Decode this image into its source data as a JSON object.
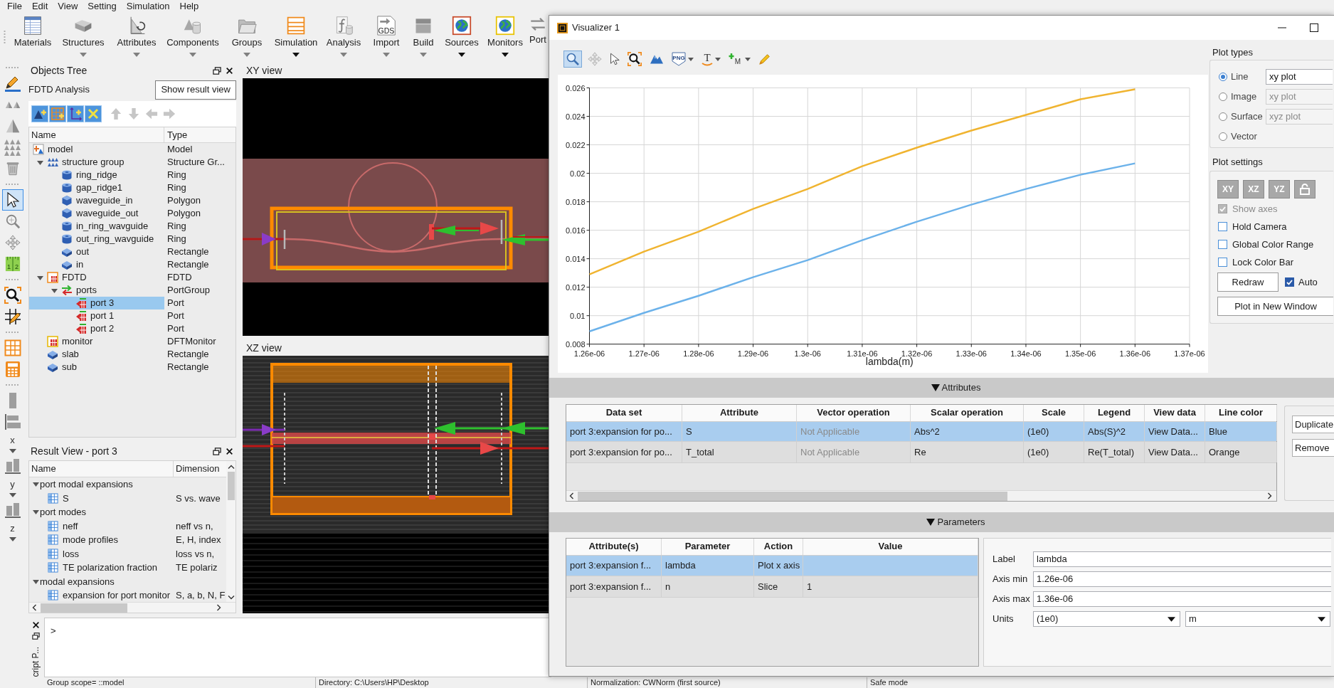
{
  "menu_bar": [
    "File",
    "Edit",
    "View",
    "Setting",
    "Simulation",
    "Help"
  ],
  "main_toolbar": [
    {
      "label": "Materials",
      "kind": "materials",
      "menu": false
    },
    {
      "label": "Structures",
      "kind": "structures",
      "menu": true,
      "menu_active": false
    },
    {
      "label": "Attributes",
      "kind": "attributes",
      "menu": true,
      "menu_active": false
    },
    {
      "label": "Components",
      "kind": "components",
      "menu": true,
      "menu_active": false
    },
    {
      "label": "Groups",
      "kind": "groups",
      "menu": true,
      "menu_active": false
    },
    {
      "label": "Simulation",
      "kind": "simulation",
      "menu": true,
      "menu_active": true
    },
    {
      "label": "Analysis",
      "kind": "analysis",
      "menu": true,
      "menu_active": false
    },
    {
      "label": "Import",
      "kind": "import",
      "menu": true,
      "menu_active": false,
      "icon_text": "GDS"
    },
    {
      "label": "Build",
      "kind": "build",
      "menu": true,
      "menu_active": false
    },
    {
      "label": "Sources",
      "kind": "sources",
      "menu": true,
      "menu_active": true
    },
    {
      "label": "Monitors",
      "kind": "monitors",
      "menu": true,
      "menu_active": true
    },
    {
      "label": "Port",
      "kind": "ports",
      "menu": false
    }
  ],
  "side_tools": [
    {
      "kind": "grip"
    },
    {
      "kind": "pencil",
      "selected": false
    },
    {
      "kind": "triangles",
      "selected": false
    },
    {
      "kind": "triangle",
      "selected": false
    },
    {
      "kind": "triangle-grid",
      "selected": false
    },
    {
      "kind": "trash",
      "selected": false
    },
    {
      "kind": "grip"
    },
    {
      "kind": "pointer",
      "selected": true
    },
    {
      "kind": "zoom",
      "selected": false
    },
    {
      "kind": "move",
      "selected": false
    },
    {
      "kind": "ruler",
      "selected": false,
      "icon_text": [
        "1",
        "2"
      ]
    },
    {
      "kind": "grip"
    },
    {
      "kind": "zoom-region",
      "selected": false
    },
    {
      "kind": "grid-edit",
      "selected": false
    },
    {
      "kind": "grip"
    },
    {
      "kind": "grid",
      "selected": false
    },
    {
      "kind": "calculator",
      "selected": false
    },
    {
      "kind": "grip"
    },
    {
      "kind": "vertical-bar",
      "selected": false
    },
    {
      "kind": "align",
      "selected": false
    },
    {
      "kind": "axis",
      "label": "x"
    },
    {
      "kind": "bars",
      "selected": false
    },
    {
      "kind": "axis",
      "label": "y"
    },
    {
      "kind": "bars",
      "selected": false
    },
    {
      "kind": "axis",
      "label": "z"
    }
  ],
  "objects_tree": {
    "title": "Objects Tree",
    "context": "FDTD Analysis",
    "show_result_button": "Show result view",
    "tools": [
      {
        "kind": "add-structure",
        "disabled": false
      },
      {
        "kind": "add-mesh",
        "disabled": false
      },
      {
        "kind": "add-axis",
        "disabled": false
      },
      {
        "kind": "delete",
        "disabled": false
      },
      {
        "kind": "up",
        "disabled": true
      },
      {
        "kind": "down",
        "disabled": true
      },
      {
        "kind": "left",
        "disabled": true
      },
      {
        "kind": "right",
        "disabled": true
      }
    ],
    "columns": [
      "Name",
      "Type"
    ],
    "items": [
      {
        "name": "model",
        "type": "Model",
        "kind": "model",
        "selected": false,
        "children": [
          {
            "name": "structure group",
            "type": "Structure Gr...",
            "kind": "group",
            "selected": false,
            "expanded": true,
            "children": [
              {
                "name": "ring_ridge",
                "type": "Ring",
                "kind": "ring",
                "selected": false
              },
              {
                "name": "gap_ridge1",
                "type": "Ring",
                "kind": "ring",
                "selected": false
              },
              {
                "name": "waveguide_in",
                "type": "Polygon",
                "kind": "polygon",
                "selected": false
              },
              {
                "name": "waveguide_out",
                "type": "Polygon",
                "kind": "polygon",
                "selected": false
              },
              {
                "name": "in_ring_wavguide",
                "type": "Ring",
                "kind": "ring",
                "selected": false
              },
              {
                "name": "out_ring_wavguide",
                "type": "Ring",
                "kind": "ring",
                "selected": false
              },
              {
                "name": "out",
                "type": "Rectangle",
                "kind": "rectangle",
                "selected": false
              },
              {
                "name": "in",
                "type": "Rectangle",
                "kind": "rectangle",
                "selected": false
              }
            ]
          },
          {
            "name": "FDTD",
            "type": "FDTD",
            "kind": "fdtd",
            "selected": false,
            "expanded": true,
            "children": [
              {
                "name": "ports",
                "type": "PortGroup",
                "kind": "portgroup",
                "selected": false,
                "expanded": true,
                "children": [
                  {
                    "name": "port 3",
                    "type": "Port",
                    "kind": "port",
                    "selected": true
                  },
                  {
                    "name": "port 1",
                    "type": "Port",
                    "kind": "port",
                    "selected": false
                  },
                  {
                    "name": "port 2",
                    "type": "Port",
                    "kind": "port",
                    "selected": false
                  }
                ]
              }
            ]
          },
          {
            "name": "monitor",
            "type": "DFTMonitor",
            "kind": "monitor",
            "selected": false
          },
          {
            "name": "slab",
            "type": "Rectangle",
            "kind": "rectangle",
            "selected": false
          },
          {
            "name": "sub",
            "type": "Rectangle",
            "kind": "rectangle",
            "selected": false
          }
        ]
      }
    ]
  },
  "result_view": {
    "title": "Result View - port 3",
    "columns": [
      "Name",
      "Dimension"
    ],
    "items": [
      {
        "name": "port modal expansions",
        "selected": false,
        "expanded": true,
        "children": [
          {
            "name": "S",
            "dimension": "S vs. wave",
            "selected": false
          }
        ]
      },
      {
        "name": "port modes",
        "selected": false,
        "expanded": true,
        "children": [
          {
            "name": "neff",
            "dimension": "neff vs n,",
            "selected": false
          },
          {
            "name": "mode profiles",
            "dimension": "E, H, index",
            "selected": false
          },
          {
            "name": "loss",
            "dimension": "loss vs n,",
            "selected": false
          },
          {
            "name": "TE polarization fraction",
            "dimension": "TE polariz",
            "selected": false
          }
        ]
      },
      {
        "name": "modal expansions",
        "selected": false,
        "expanded": true,
        "children": [
          {
            "name": "expansion for port monitor",
            "dimension": "S, a, b, N, F",
            "selected": false
          }
        ]
      }
    ]
  },
  "views": [
    {
      "title": "XY view",
      "kind": "xy"
    },
    {
      "title": "XZ view",
      "kind": "xz"
    }
  ],
  "console": {
    "tab_label": "cript P...",
    "prompt": ">"
  },
  "status_bar": [
    "Group scope= ::model",
    "Directory: C:\\Users\\HP\\Desktop",
    "Normalization: CWNorm (first source)",
    "Safe mode"
  ],
  "visualizer": {
    "title": "Visualizer 1",
    "tools": [
      {
        "kind": "zoom",
        "selected": true,
        "menu": false
      },
      {
        "kind": "pan",
        "selected": false,
        "menu": false
      },
      {
        "kind": "pointer",
        "selected": false,
        "menu": false
      },
      {
        "kind": "zoom-box",
        "selected": false,
        "menu": false
      },
      {
        "kind": "surface",
        "selected": false,
        "menu": false
      },
      {
        "kind": "png",
        "selected": false,
        "menu": true,
        "icon_text": "PNG"
      },
      {
        "kind": "text",
        "selected": false,
        "menu": true,
        "icon_text": "T"
      },
      {
        "kind": "marker",
        "selected": false,
        "menu": true,
        "icon_text": "M"
      },
      {
        "kind": "pencil",
        "selected": false,
        "menu": false
      }
    ],
    "plot": {
      "chart_data": {
        "type": "line",
        "xlabel": "lambda(m)",
        "grid": true,
        "x": [
          1.26e-06,
          1.27e-06,
          1.28e-06,
          1.29e-06,
          1.3e-06,
          1.31e-06,
          1.32e-06,
          1.33e-06,
          1.34e-06,
          1.35e-06,
          1.36e-06
        ],
        "series": [
          {
            "color": "#6cb2ea",
            "values": [
              0.0089,
              0.0102,
              0.0114,
              0.0127,
              0.0139,
              0.0153,
              0.0166,
              0.0178,
              0.0189,
              0.0199,
              0.0207
            ]
          },
          {
            "color": "#f0b430",
            "values": [
              0.0129,
              0.0145,
              0.0159,
              0.0175,
              0.0189,
              0.0205,
              0.0218,
              0.023,
              0.0241,
              0.0252,
              0.0259
            ]
          }
        ],
        "xlim": [
          1.26e-06,
          1.37e-06
        ],
        "ylim": [
          0.008,
          0.026
        ],
        "xticks": [
          {
            "value": 1.26e-06,
            "label": "1.26e-06"
          },
          {
            "value": 1.27e-06,
            "label": "1.27e-06"
          },
          {
            "value": 1.28e-06,
            "label": "1.28e-06"
          },
          {
            "value": 1.29e-06,
            "label": "1.29e-06"
          },
          {
            "value": 1.3e-06,
            "label": "1.3e-06"
          },
          {
            "value": 1.31e-06,
            "label": "1.31e-06"
          },
          {
            "value": 1.32e-06,
            "label": "1.32e-06"
          },
          {
            "value": 1.33e-06,
            "label": "1.33e-06"
          },
          {
            "value": 1.34e-06,
            "label": "1.34e-06"
          },
          {
            "value": 1.35e-06,
            "label": "1.35e-06"
          },
          {
            "value": 1.36e-06,
            "label": "1.36e-06"
          },
          {
            "value": 1.37e-06,
            "label": "1.37e-06"
          }
        ],
        "yticks": [
          0.008,
          0.01,
          0.012,
          0.014,
          0.016,
          0.018,
          0.02,
          0.022,
          0.024,
          0.026
        ]
      }
    },
    "plot_types": {
      "title": "Plot types",
      "options": [
        {
          "label": "Line",
          "selected": true,
          "field": "xy plot",
          "field_disabled": false
        },
        {
          "label": "Image",
          "selected": false,
          "field": "xy plot",
          "field_disabled": true
        },
        {
          "label": "Surface",
          "selected": false,
          "field": "xyz plot",
          "field_disabled": true
        },
        {
          "label": "Vector",
          "selected": false
        }
      ]
    },
    "plot_settings": {
      "title": "Plot settings",
      "view_buttons": [
        "XY",
        "XZ",
        "YZ"
      ],
      "options": [
        {
          "label": "Show axes",
          "checked": true,
          "disabled": true
        },
        {
          "label": "Hold Camera",
          "checked": false,
          "disabled": false
        },
        {
          "label": "Global Color Range",
          "checked": false,
          "disabled": false
        },
        {
          "label": "Lock Color Bar",
          "checked": false,
          "disabled": false
        }
      ],
      "redraw": "Redraw",
      "auto": {
        "label": "Auto",
        "checked": true
      },
      "new_window": "Plot in New Window"
    },
    "attributes": {
      "title": "Attributes",
      "expanded": true,
      "columns": [
        {
          "label": "Data set",
          "disabled": false
        },
        {
          "label": "Attribute",
          "disabled": false
        },
        {
          "label": "Vector operation",
          "disabled": true
        },
        {
          "label": "Scalar operation",
          "disabled": false
        },
        {
          "label": "Scale",
          "disabled": false
        },
        {
          "label": "Legend",
          "disabled": false
        },
        {
          "label": "View data",
          "disabled": false
        },
        {
          "label": "Line color",
          "disabled": false
        }
      ],
      "rows": [
        {
          "selected": true,
          "cells": [
            "port 3:expansion for po...",
            "S",
            "Not Applicable",
            "Abs^2",
            "(1e0)",
            "Abs(S)^2",
            "View Data...",
            "Blue"
          ]
        },
        {
          "selected": false,
          "cells": [
            "port 3:expansion for po...",
            "T_total",
            "Not Applicable",
            "Re",
            "(1e0)",
            "Re(T_total)",
            "View Data...",
            "Orange"
          ]
        }
      ],
      "buttons": [
        "Duplicate",
        "Remove"
      ]
    },
    "parameters": {
      "title": "Parameters",
      "expanded": true,
      "columns": [
        "Attribute(s)",
        "Parameter",
        "Action",
        "Value"
      ],
      "rows": [
        {
          "selected": true,
          "cells": [
            "port 3:expansion f...",
            "lambda",
            "Plot x axis"
          ]
        },
        {
          "selected": false,
          "cells": [
            "port 3:expansion f...",
            "n",
            "Slice",
            "1"
          ]
        }
      ],
      "fields": [
        {
          "label": "Label",
          "value": "lambda"
        },
        {
          "label": "Axis min",
          "value": "1.26e-06"
        },
        {
          "label": "Axis max",
          "value": "1.36e-06"
        }
      ],
      "units": {
        "label": "Units",
        "scale": "(1e0)",
        "unit": "m"
      }
    }
  }
}
